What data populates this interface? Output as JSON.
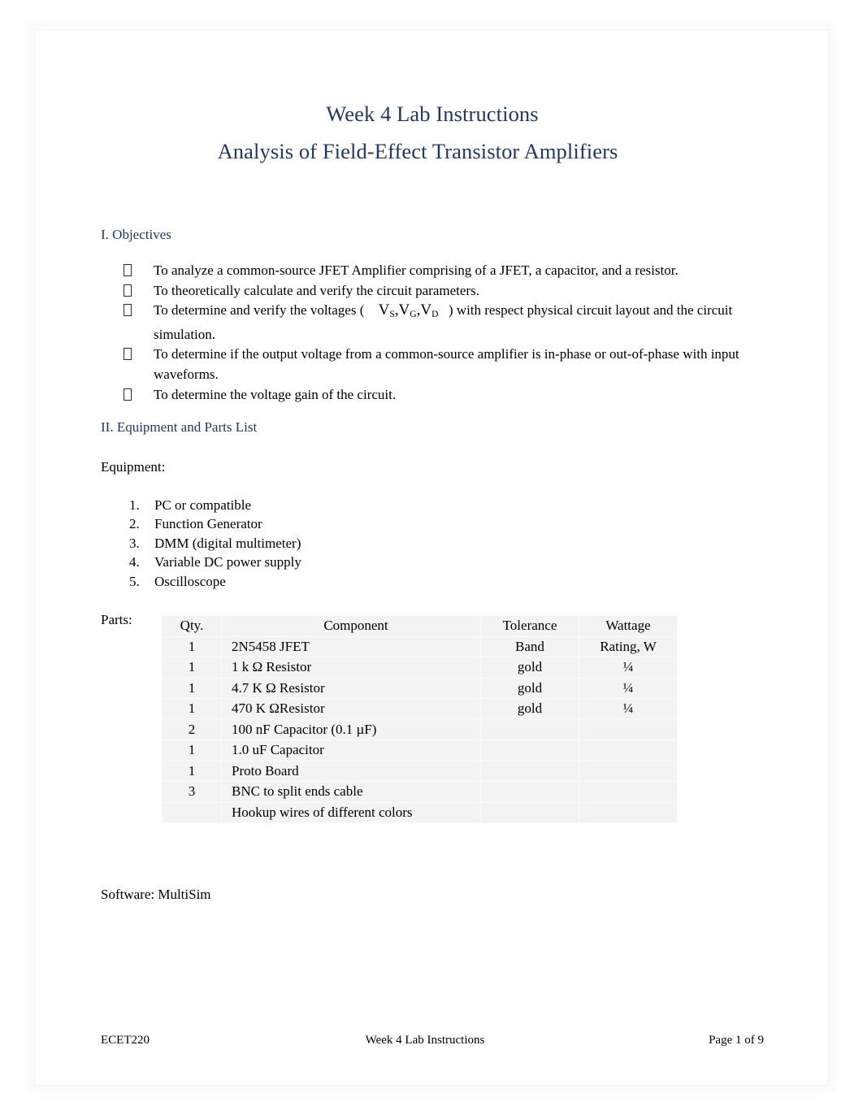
{
  "document": {
    "title_line_1": "Week 4 Lab Instructions",
    "title_line_2": "Analysis of Field-Effect Transistor Amplifiers",
    "heading_color": "#1F3864",
    "body_color": "#000000",
    "table_background": "#F3F3F3"
  },
  "objectives": {
    "heading": "I. Objectives",
    "bullet_glyph": "missing-glyph-box",
    "items": [
      {
        "text": "To analyze a common-source JFET Amplifier comprising of a JFET, a capacitor, and a resistor."
      },
      {
        "text": "To theoretically calculate and verify the circuit parameters."
      },
      {
        "text_before": "To determine and verify the voltages (",
        "math": "V_S , V_G , V_D",
        "math_parts": [
          "V",
          "S",
          "V",
          "G",
          "V",
          "D"
        ],
        "text_after": ") with respect physical circuit layout and the circuit simulation."
      },
      {
        "text": "To determine if the output voltage from a common-source amplifier is in-phase or out-of-phase with input waveforms."
      },
      {
        "text": "To determine the voltage gain of the circuit."
      }
    ]
  },
  "equipment_section": {
    "heading": "II. Equipment and Parts List",
    "equipment_label": "Equipment:",
    "equipment_items": [
      {
        "number": "1.",
        "name": "PC or compatible"
      },
      {
        "number": "2.",
        "name": "Function Generator"
      },
      {
        "number": "3.",
        "name": "DMM (digital multimeter)"
      },
      {
        "number": "4.",
        "name": "Variable DC power supply"
      },
      {
        "number": "5.",
        "name": "Oscilloscope"
      }
    ],
    "parts_label": "Parts:",
    "software_label": "Software: MultiSim"
  },
  "parts_table": {
    "headers_line_1": [
      "Qty.",
      "Component",
      "Tolerance",
      "Wattage"
    ],
    "rows": [
      {
        "qty": "1",
        "component": "2N5458 JFET",
        "tolerance": "Band",
        "wattage": "Rating, W"
      },
      {
        "qty": "1",
        "component": "1 k Ω Resistor",
        "tolerance": "gold",
        "wattage": "¼"
      },
      {
        "qty": "1",
        "component": "4.7 K Ω Resistor",
        "tolerance": "gold",
        "wattage": "¼"
      },
      {
        "qty": "1",
        "component": "470 K ΩResistor",
        "tolerance": "gold",
        "wattage": "¼"
      },
      {
        "qty": "2",
        "component": "100 nF Capacitor (0.1 µF)",
        "tolerance": "",
        "wattage": ""
      },
      {
        "qty": "1",
        "component": "1.0 uF Capacitor",
        "tolerance": "",
        "wattage": ""
      },
      {
        "qty": "1",
        "component": "Proto Board",
        "tolerance": "",
        "wattage": ""
      },
      {
        "qty": "3",
        "component": "BNC to split ends cable",
        "tolerance": "",
        "wattage": ""
      },
      {
        "qty": "",
        "component": "Hookup wires of different colors",
        "tolerance": "",
        "wattage": ""
      }
    ]
  },
  "footer": {
    "left": "ECET220",
    "center": "Week 4 Lab Instructions",
    "right": "Page 1 of 9"
  }
}
